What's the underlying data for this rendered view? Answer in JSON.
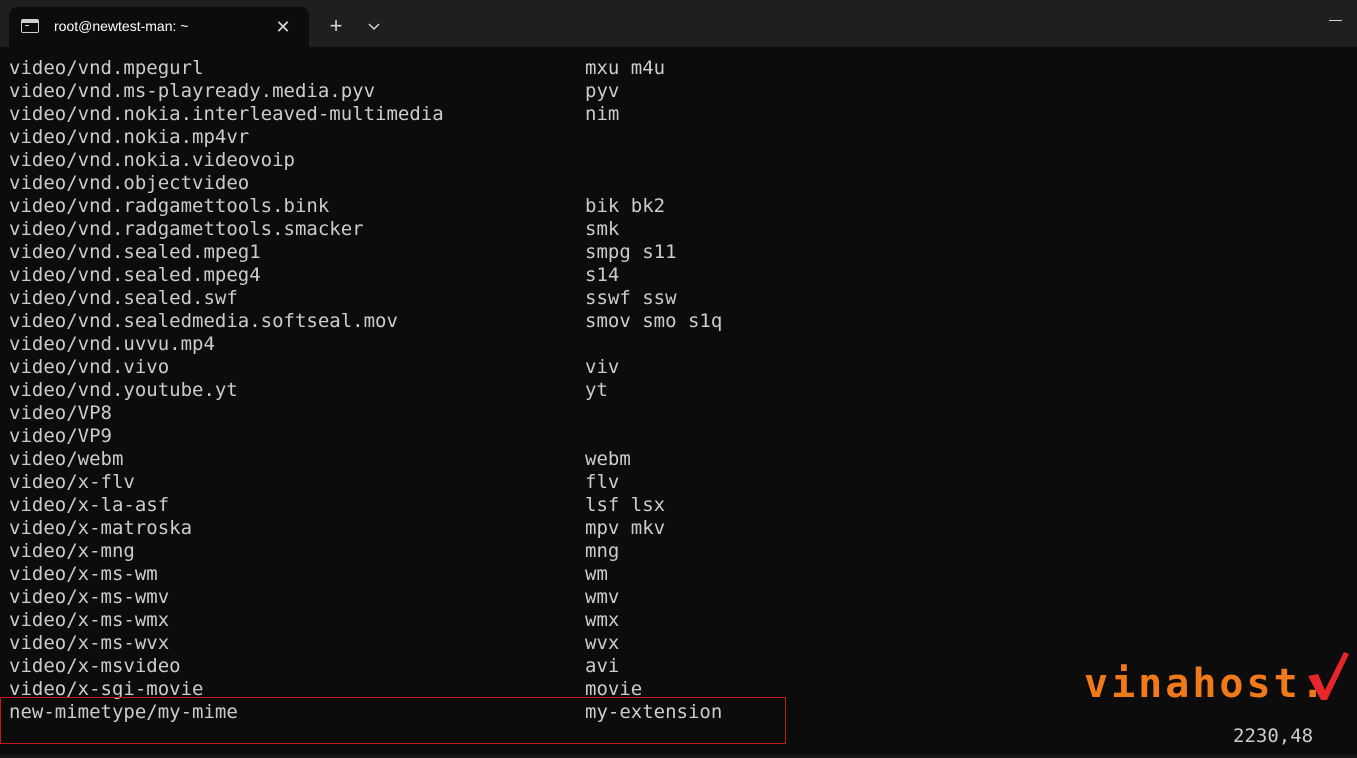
{
  "tab": {
    "title": "root@newtest-man: ~",
    "icon": "terminal-icon",
    "close_glyph": "✕"
  },
  "tabbar": {
    "new_tab_glyph": "+",
    "dropdown_icon": "chevron-down-icon",
    "minimize_icon": "minimize-icon"
  },
  "terminal": {
    "rows": [
      {
        "mime": "video/vnd.mpegurl",
        "ext": "mxu m4u"
      },
      {
        "mime": "video/vnd.ms-playready.media.pyv",
        "ext": "pyv"
      },
      {
        "mime": "video/vnd.nokia.interleaved-multimedia",
        "ext": "nim"
      },
      {
        "mime": "video/vnd.nokia.mp4vr",
        "ext": ""
      },
      {
        "mime": "video/vnd.nokia.videovoip",
        "ext": ""
      },
      {
        "mime": "video/vnd.objectvideo",
        "ext": ""
      },
      {
        "mime": "video/vnd.radgamettools.bink",
        "ext": "bik bk2"
      },
      {
        "mime": "video/vnd.radgamettools.smacker",
        "ext": "smk"
      },
      {
        "mime": "video/vnd.sealed.mpeg1",
        "ext": "smpg s11"
      },
      {
        "mime": "video/vnd.sealed.mpeg4",
        "ext": "s14"
      },
      {
        "mime": "video/vnd.sealed.swf",
        "ext": "sswf ssw"
      },
      {
        "mime": "video/vnd.sealedmedia.softseal.mov",
        "ext": "smov smo s1q"
      },
      {
        "mime": "video/vnd.uvvu.mp4",
        "ext": ""
      },
      {
        "mime": "video/vnd.vivo",
        "ext": "viv"
      },
      {
        "mime": "video/vnd.youtube.yt",
        "ext": "yt"
      },
      {
        "mime": "video/VP8",
        "ext": ""
      },
      {
        "mime": "video/VP9",
        "ext": ""
      },
      {
        "mime": "video/webm",
        "ext": "webm"
      },
      {
        "mime": "video/x-flv",
        "ext": "flv"
      },
      {
        "mime": "video/x-la-asf",
        "ext": "lsf lsx"
      },
      {
        "mime": "video/x-matroska",
        "ext": "mpv mkv"
      },
      {
        "mime": "video/x-mng",
        "ext": "mng"
      },
      {
        "mime": "video/x-ms-wm",
        "ext": "wm"
      },
      {
        "mime": "video/x-ms-wmv",
        "ext": "wmv"
      },
      {
        "mime": "video/x-ms-wmx",
        "ext": "wmx"
      },
      {
        "mime": "video/x-ms-wvx",
        "ext": "wvx"
      },
      {
        "mime": "video/x-msvideo",
        "ext": "avi"
      },
      {
        "mime": "video/x-sgi-movie",
        "ext": "movie"
      },
      {
        "mime": "new-mimetype/my-mime",
        "ext": "my-extension"
      }
    ],
    "cursor_position": "2230,48",
    "highlight_color": "#c0161c",
    "text_color": "#cccccc",
    "background_color": "#0c0c0c"
  },
  "watermark": {
    "text": "vinahost.",
    "color": "#f07a1a",
    "check_color": "#e8262a"
  }
}
